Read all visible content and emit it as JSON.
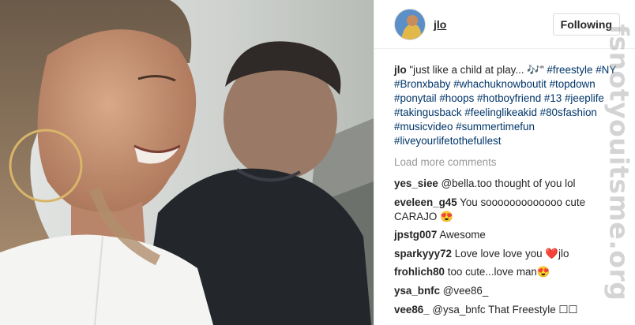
{
  "header": {
    "username": "jlo",
    "follow_label": "Following"
  },
  "caption": {
    "username": "jlo",
    "text": "\"just like a child at play... 🎶\"",
    "hashtags": [
      "#freestyle",
      "#NY",
      "#Bronxbaby",
      "#whachuknowboutit",
      "#topdown",
      "#ponytail",
      "#hoops",
      "#hotboyfriend",
      "#13",
      "#jeeplife",
      "#takingusback",
      "#feelinglikeakid",
      "#80sfashion",
      "#musicvideo",
      "#summertimefun",
      "#liveyourlifetothefullest"
    ]
  },
  "load_more": "Load more comments",
  "comments": [
    {
      "user": "yes_siee",
      "text": "@bella.too thought of you lol"
    },
    {
      "user": "eveleen_g45",
      "text": "You sooooooooooooo cute CARAJO 😍"
    },
    {
      "user": "jpstg007",
      "text": "Awesome"
    },
    {
      "user": "sparkyyy72",
      "text": "Love love love you ❤️jlo"
    },
    {
      "user": "frohlich80",
      "text": "too cute...love man😍"
    },
    {
      "user": "ysa_bnfc",
      "text": "@vee86_"
    },
    {
      "user": "vee86_",
      "text": "@ysa_bnfc That Freestyle ☐☐"
    }
  ],
  "watermark": "fsnotyouitsme.org",
  "icons": {
    "avatar": "profile-avatar",
    "media": "post-photo"
  }
}
